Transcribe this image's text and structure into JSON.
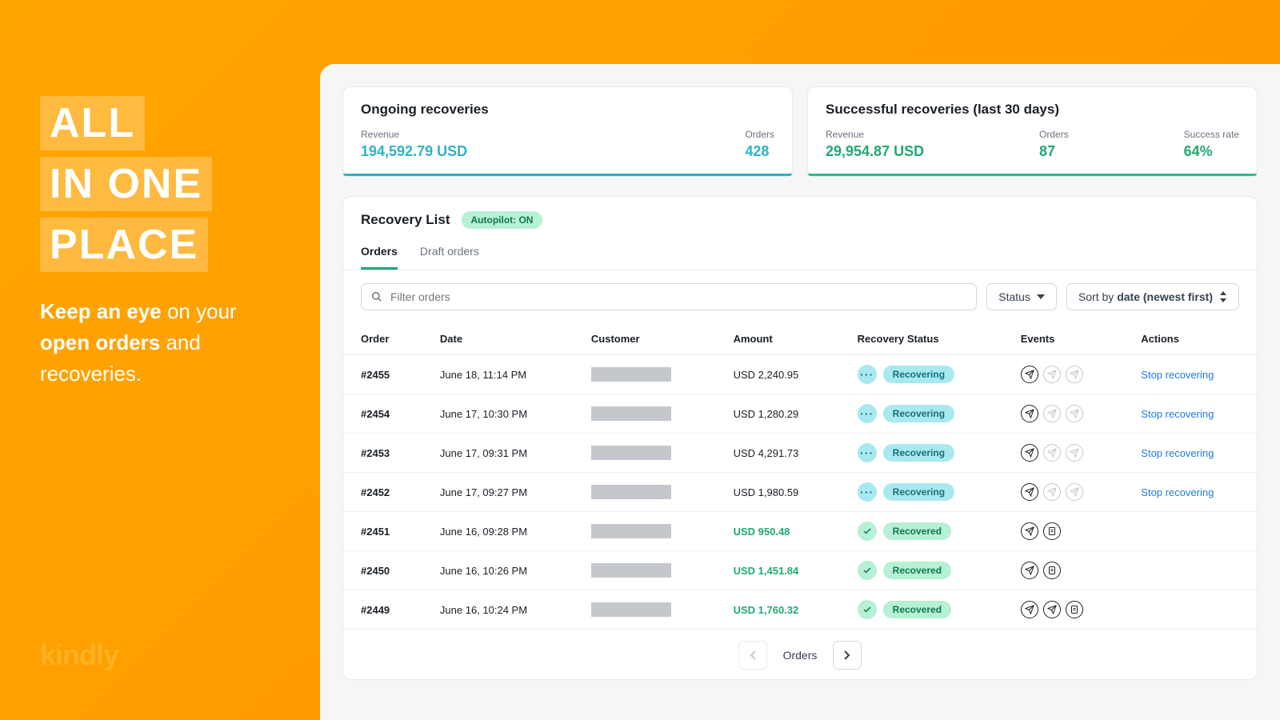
{
  "hero": {
    "line1": "ALL",
    "line2": "IN ONE",
    "line3": "PLACE",
    "subtitle_strong1": "Keep an eye",
    "subtitle_mid1": " on your ",
    "subtitle_strong2": "open orders",
    "subtitle_mid2": " and recoveries.",
    "brand": "kindly"
  },
  "cards": {
    "ongoing": {
      "title": "Ongoing recoveries",
      "revenue_label": "Revenue",
      "revenue_value": "194,592.79 USD",
      "orders_label": "Orders",
      "orders_value": "428"
    },
    "success": {
      "title": "Successful recoveries (last 30 days)",
      "revenue_label": "Revenue",
      "revenue_value": "29,954.87 USD",
      "orders_label": "Orders",
      "orders_value": "87",
      "rate_label": "Success rate",
      "rate_value": "64%"
    }
  },
  "recovery": {
    "title": "Recovery List",
    "autopilot": "Autopilot: ON",
    "tabs": {
      "orders": "Orders",
      "draft": "Draft orders"
    },
    "filter_placeholder": "Filter orders",
    "status_btn": "Status",
    "sort_prefix": "Sort by ",
    "sort_value": "date (newest first)"
  },
  "table": {
    "headers": {
      "order": "Order",
      "date": "Date",
      "customer": "Customer",
      "amount": "Amount",
      "status": "Recovery Status",
      "events": "Events",
      "actions": "Actions"
    },
    "status_labels": {
      "recovering": "Recovering",
      "recovered": "Recovered"
    },
    "action_stop": "Stop recovering",
    "rows": [
      {
        "id": "#2455",
        "date": "June 18, 11:14 PM",
        "amount": "USD 2,240.95",
        "status": "recovering",
        "events": [
          1,
          0,
          0
        ],
        "action": "stop"
      },
      {
        "id": "#2454",
        "date": "June 17, 10:30 PM",
        "amount": "USD 1,280.29",
        "status": "recovering",
        "events": [
          1,
          0,
          0
        ],
        "action": "stop"
      },
      {
        "id": "#2453",
        "date": "June 17, 09:31 PM",
        "amount": "USD 4,291.73",
        "status": "recovering",
        "events": [
          1,
          0,
          0
        ],
        "action": "stop"
      },
      {
        "id": "#2452",
        "date": "June 17, 09:27 PM",
        "amount": "USD 1,980.59",
        "status": "recovering",
        "events": [
          1,
          0,
          0
        ],
        "action": "stop"
      },
      {
        "id": "#2451",
        "date": "June 16, 09:28 PM",
        "amount": "USD 950.48",
        "status": "recovered",
        "events": [
          1,
          2
        ],
        "action": ""
      },
      {
        "id": "#2450",
        "date": "June 16, 10:26 PM",
        "amount": "USD 1,451.84",
        "status": "recovered",
        "events": [
          1,
          2
        ],
        "action": ""
      },
      {
        "id": "#2449",
        "date": "June 16, 10:24 PM",
        "amount": "USD 1,760.32",
        "status": "recovered",
        "events": [
          1,
          1,
          2
        ],
        "action": ""
      }
    ]
  },
  "pagination": {
    "label": "Orders"
  }
}
